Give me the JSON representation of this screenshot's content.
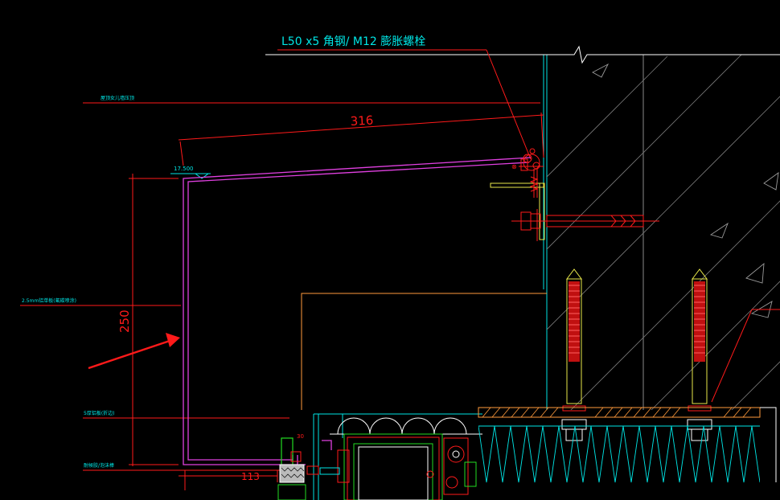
{
  "drawing": {
    "callout_main": "L50 x5 角钢/ M12 膨胀螺栓",
    "dim_316": "316",
    "dim_250": "250",
    "dim_113": "113",
    "dim_30": "30",
    "level": "17.500",
    "label_top": "屋顶女儿墙压顶",
    "label_mid": "2.5mm铝单板(氟碳喷涂)",
    "label_low1": "5厚铝板(折边)",
    "label_low2": "耐候胶/泡沫棒"
  },
  "colors": {
    "background": "#000000",
    "cyan": "#00e5e5",
    "red": "#ff1a1a",
    "magenta": "#e040e0",
    "white": "#ffffff",
    "orange": "#ff9a3c",
    "green": "#22dd22",
    "yellow": "#e8e84a",
    "grey": "#8a8a8a"
  }
}
